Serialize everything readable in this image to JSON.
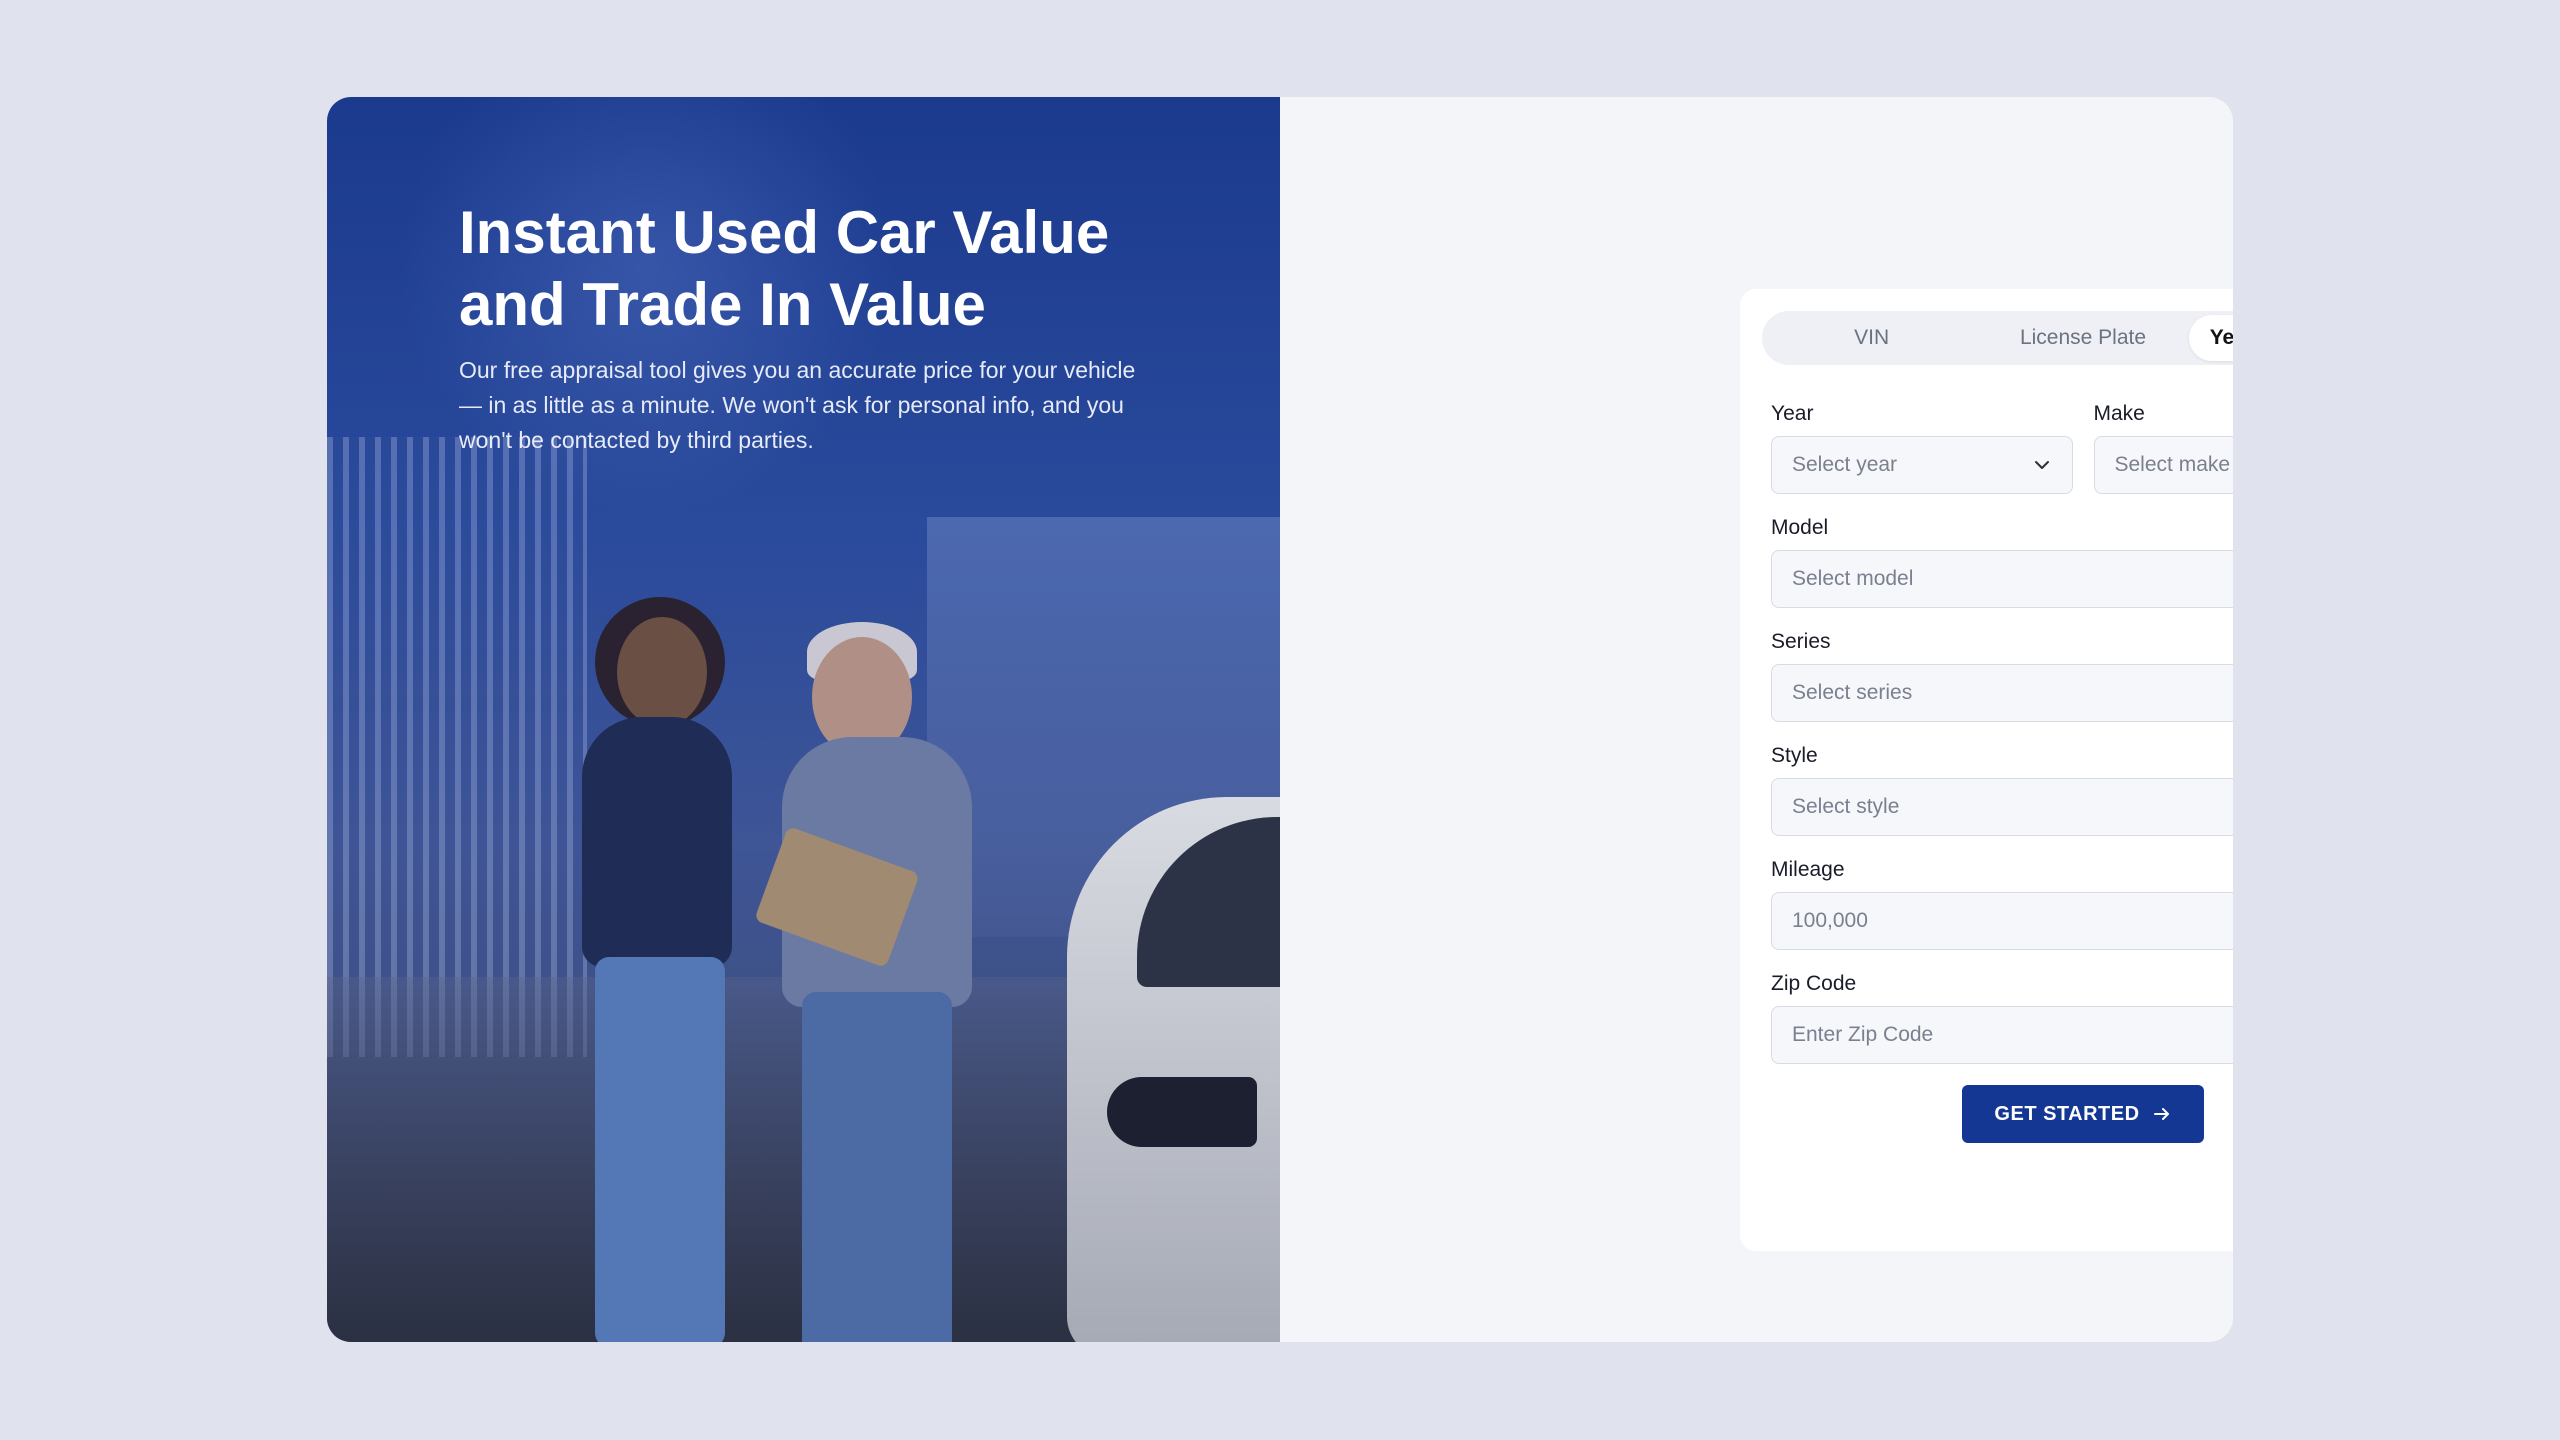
{
  "hero": {
    "title_line1": "Instant Used Car Value",
    "title_line2": "and Trade In Value",
    "description": "Our free appraisal tool gives you an accurate price for your vehicle — in as little as a minute. We won't ask for personal info, and you won't be contacted by third parties."
  },
  "tabs": [
    {
      "label": "VIN",
      "active": false
    },
    {
      "label": "License Plate",
      "active": false
    },
    {
      "label": "Year/Make/Model",
      "active": true
    }
  ],
  "form": {
    "year": {
      "label": "Year",
      "placeholder": "Select year"
    },
    "make": {
      "label": "Make",
      "placeholder": "Select make"
    },
    "model": {
      "label": "Model",
      "placeholder": "Select model"
    },
    "series": {
      "label": "Series",
      "placeholder": "Select series"
    },
    "style": {
      "label": "Style",
      "placeholder": "Select style"
    },
    "mileage": {
      "label": "Mileage",
      "placeholder": "100,000"
    },
    "zip": {
      "label": "Zip Code",
      "placeholder": "Enter Zip Code"
    },
    "submit_label": "GET STARTED"
  },
  "colors": {
    "accent": "#143794",
    "page_background": "#e0e2ee",
    "hero_tint": "#1b3a8e"
  },
  "icons": {
    "dropdown": "chevron-down-icon",
    "submit": "arrow-right-icon"
  }
}
